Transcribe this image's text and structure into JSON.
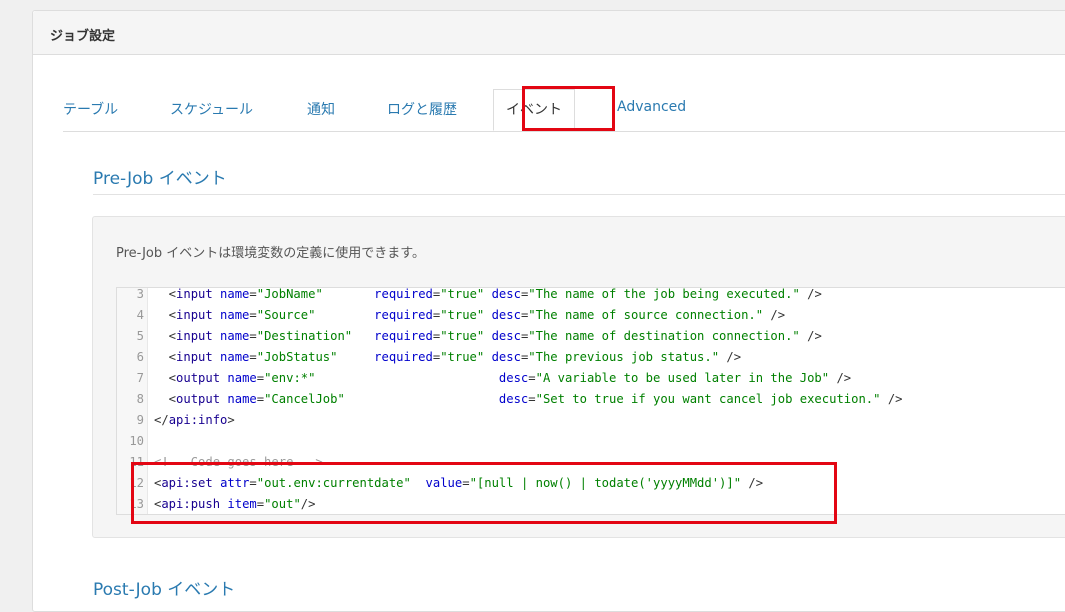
{
  "panel": {
    "title": "ジョブ設定"
  },
  "tabs": [
    {
      "label": "テーブル",
      "active": false
    },
    {
      "label": "スケジュール",
      "active": false
    },
    {
      "label": "通知",
      "active": false
    },
    {
      "label": "ログと履歴",
      "active": false
    },
    {
      "label": "イベント",
      "active": true
    },
    {
      "label": "Advanced",
      "active": false
    }
  ],
  "pre_job": {
    "title": "Pre-Job イベント",
    "description": "Pre-Job イベントは環境変数の定義に使用できます。",
    "code_lines": [
      {
        "num": "3",
        "segments": [
          [
            "p",
            "  <"
          ],
          [
            "t",
            "input"
          ],
          [
            "p",
            " "
          ],
          [
            "a",
            "name"
          ],
          [
            "p",
            "="
          ],
          [
            "s",
            "\"JobName\""
          ],
          [
            "p",
            "       "
          ],
          [
            "a",
            "required"
          ],
          [
            "p",
            "="
          ],
          [
            "s",
            "\"true\""
          ],
          [
            "p",
            " "
          ],
          [
            "a",
            "desc"
          ],
          [
            "p",
            "="
          ],
          [
            "s",
            "\"The name of the job being executed.\""
          ],
          [
            "p",
            " />"
          ]
        ]
      },
      {
        "num": "4",
        "segments": [
          [
            "p",
            "  <"
          ],
          [
            "t",
            "input"
          ],
          [
            "p",
            " "
          ],
          [
            "a",
            "name"
          ],
          [
            "p",
            "="
          ],
          [
            "s",
            "\"Source\""
          ],
          [
            "p",
            "        "
          ],
          [
            "a",
            "required"
          ],
          [
            "p",
            "="
          ],
          [
            "s",
            "\"true\""
          ],
          [
            "p",
            " "
          ],
          [
            "a",
            "desc"
          ],
          [
            "p",
            "="
          ],
          [
            "s",
            "\"The name of source connection.\""
          ],
          [
            "p",
            " />"
          ]
        ]
      },
      {
        "num": "5",
        "segments": [
          [
            "p",
            "  <"
          ],
          [
            "t",
            "input"
          ],
          [
            "p",
            " "
          ],
          [
            "a",
            "name"
          ],
          [
            "p",
            "="
          ],
          [
            "s",
            "\"Destination\""
          ],
          [
            "p",
            "   "
          ],
          [
            "a",
            "required"
          ],
          [
            "p",
            "="
          ],
          [
            "s",
            "\"true\""
          ],
          [
            "p",
            " "
          ],
          [
            "a",
            "desc"
          ],
          [
            "p",
            "="
          ],
          [
            "s",
            "\"The name of destination connection.\""
          ],
          [
            "p",
            " />"
          ]
        ]
      },
      {
        "num": "6",
        "segments": [
          [
            "p",
            "  <"
          ],
          [
            "t",
            "input"
          ],
          [
            "p",
            " "
          ],
          [
            "a",
            "name"
          ],
          [
            "p",
            "="
          ],
          [
            "s",
            "\"JobStatus\""
          ],
          [
            "p",
            "     "
          ],
          [
            "a",
            "required"
          ],
          [
            "p",
            "="
          ],
          [
            "s",
            "\"true\""
          ],
          [
            "p",
            " "
          ],
          [
            "a",
            "desc"
          ],
          [
            "p",
            "="
          ],
          [
            "s",
            "\"The previous job status.\""
          ],
          [
            "p",
            " />"
          ]
        ]
      },
      {
        "num": "7",
        "segments": [
          [
            "p",
            "  <"
          ],
          [
            "t",
            "output"
          ],
          [
            "p",
            " "
          ],
          [
            "a",
            "name"
          ],
          [
            "p",
            "="
          ],
          [
            "s",
            "\"env:*\""
          ],
          [
            "p",
            "                         "
          ],
          [
            "a",
            "desc"
          ],
          [
            "p",
            "="
          ],
          [
            "s",
            "\"A variable to be used later in the Job\""
          ],
          [
            "p",
            " />"
          ]
        ]
      },
      {
        "num": "8",
        "segments": [
          [
            "p",
            "  <"
          ],
          [
            "t",
            "output"
          ],
          [
            "p",
            " "
          ],
          [
            "a",
            "name"
          ],
          [
            "p",
            "="
          ],
          [
            "s",
            "\"CancelJob\""
          ],
          [
            "p",
            "                     "
          ],
          [
            "a",
            "desc"
          ],
          [
            "p",
            "="
          ],
          [
            "s",
            "\"Set to true if you want cancel job execution.\""
          ],
          [
            "p",
            " />"
          ]
        ]
      },
      {
        "num": "9",
        "segments": [
          [
            "p",
            "</"
          ],
          [
            "t",
            "api:info"
          ],
          [
            "p",
            ">"
          ]
        ]
      },
      {
        "num": "10",
        "segments": []
      },
      {
        "num": "11",
        "segments": [
          [
            "c",
            "<!-- Code goes here -->"
          ]
        ]
      },
      {
        "num": "12",
        "segments": [
          [
            "p",
            "<"
          ],
          [
            "t",
            "api:set"
          ],
          [
            "p",
            " "
          ],
          [
            "a",
            "attr"
          ],
          [
            "p",
            "="
          ],
          [
            "s",
            "\"out.env:currentdate\""
          ],
          [
            "p",
            "  "
          ],
          [
            "a",
            "value"
          ],
          [
            "p",
            "="
          ],
          [
            "s",
            "\"[null | now() | todate('yyyyMMdd')]\""
          ],
          [
            "p",
            " />"
          ]
        ]
      },
      {
        "num": "13",
        "segments": [
          [
            "p",
            "<"
          ],
          [
            "t",
            "api:push"
          ],
          [
            "p",
            " "
          ],
          [
            "a",
            "item"
          ],
          [
            "p",
            "="
          ],
          [
            "s",
            "\"out\""
          ],
          [
            "p",
            "/>"
          ]
        ]
      }
    ]
  },
  "post_job": {
    "title": "Post-Job イベント"
  },
  "colors": {
    "link": "#2a7ab0",
    "highlight": "#e30613",
    "tag": "#170090",
    "attribute": "#0000cc",
    "string": "#008000",
    "comment": "#999999"
  }
}
